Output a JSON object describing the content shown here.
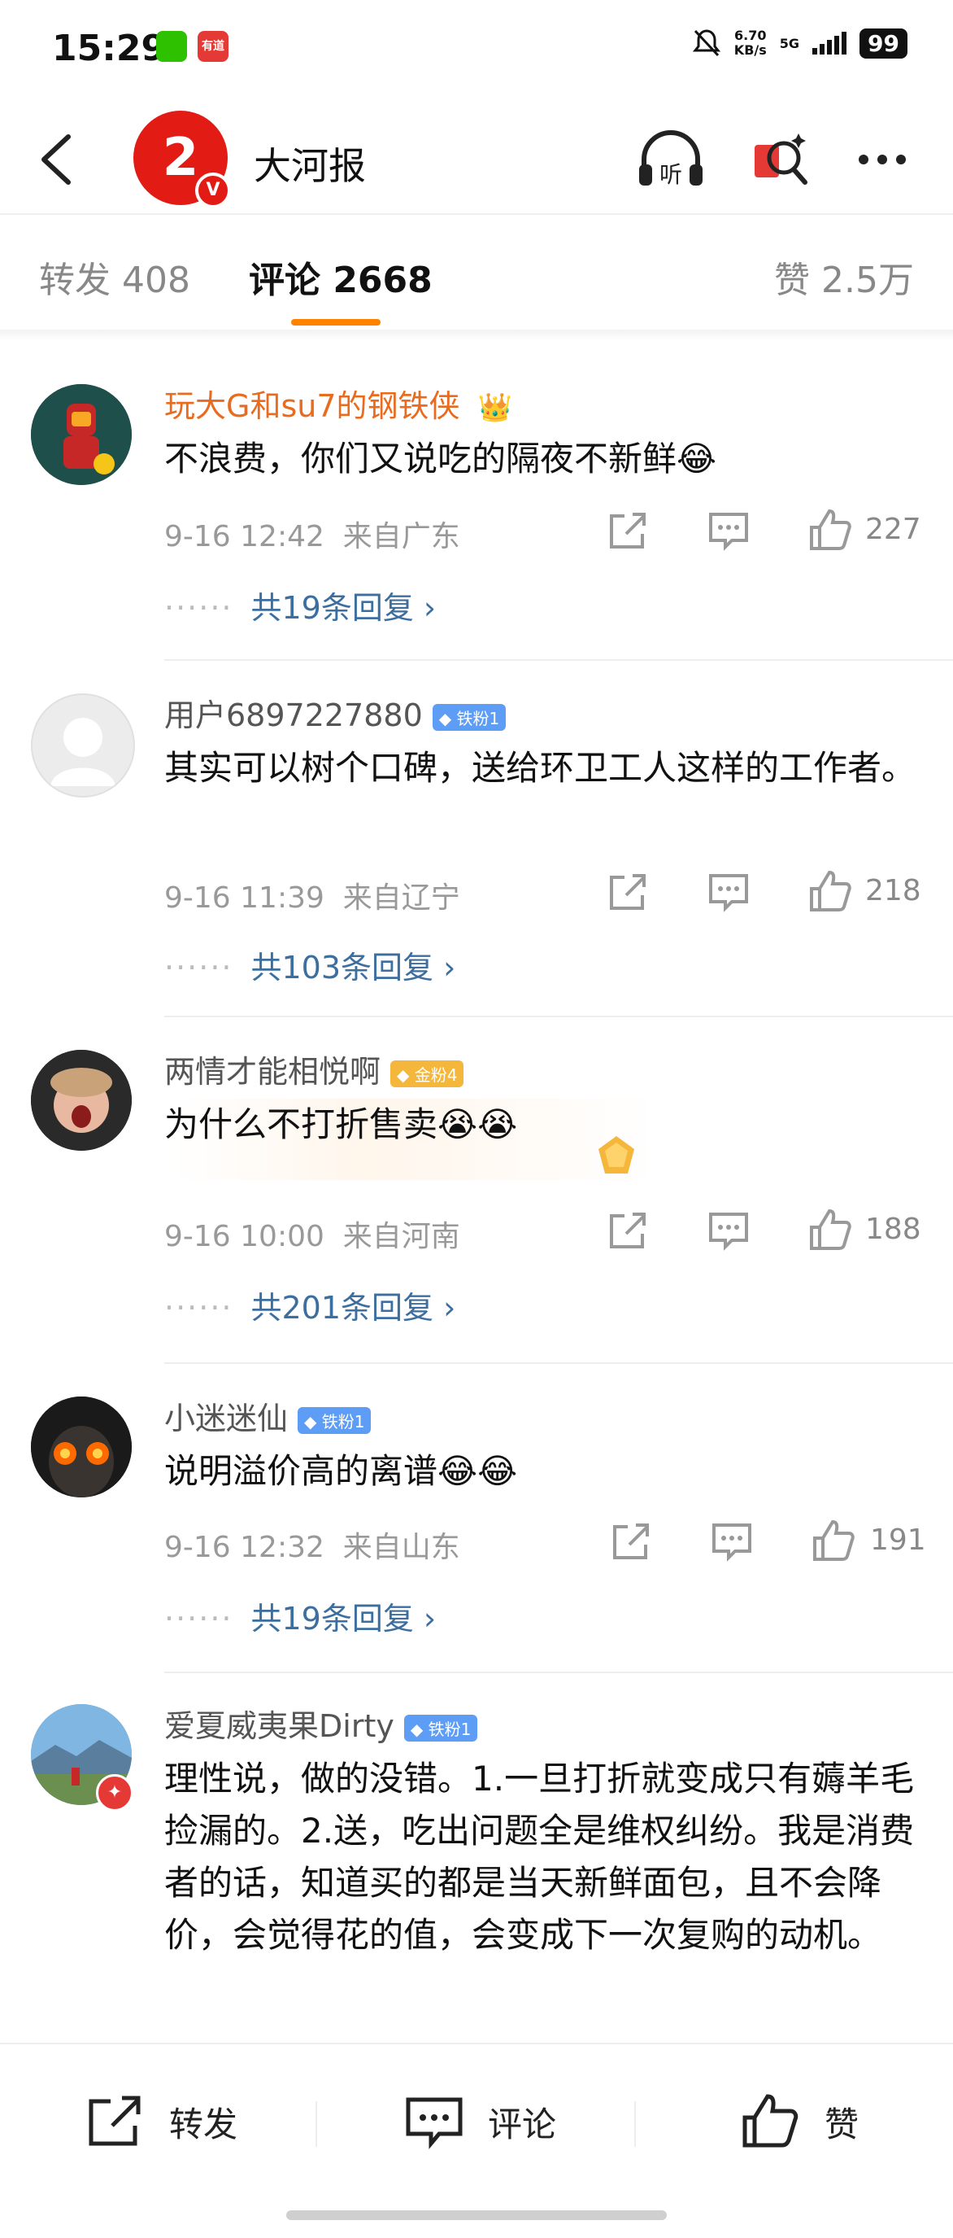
{
  "status_bar": {
    "time": "15:29",
    "app_badge": "有道",
    "speed_value": "6.70",
    "speed_unit": "KB/s",
    "network": "5G",
    "battery": "99"
  },
  "header": {
    "account_name": "大河报",
    "avatar_glyph": "2",
    "verified_mark": "V",
    "listen_label": "听"
  },
  "tabs": {
    "repost": "转发 408",
    "comment": "评论 2668",
    "like": "赞 2.5万"
  },
  "comments": [
    {
      "username": "玩大G和su7的钢铁侠",
      "badge": "",
      "text": "不浪费，你们又说吃的隔夜不新鲜😂",
      "time": "9-16 12:42",
      "location": "来自广东",
      "likes": "227",
      "replies": "共19条回复 ›"
    },
    {
      "username": "用户6897227880",
      "badge": "◆ 铁粉1",
      "text": "其实可以树个口碑，送给环卫工人这样的工作者。",
      "time": "9-16 11:39",
      "location": "来自辽宁",
      "likes": "218",
      "replies": "共103条回复 ›"
    },
    {
      "username": "两情才能相悦啊",
      "badge": "◆ 金粉4",
      "text": "为什么不打折售卖😭😭",
      "time": "9-16 10:00",
      "location": "来自河南",
      "likes": "188",
      "replies": "共201条回复 ›"
    },
    {
      "username": "小迷迷仙",
      "badge": "◆ 铁粉1",
      "text": "说明溢价高的离谱😂😂",
      "time": "9-16 12:32",
      "location": "来自山东",
      "likes": "191",
      "replies": "共19条回复 ›"
    },
    {
      "username": "爱夏威夷果Dirty",
      "badge": "◆ 铁粉1",
      "text": "理性说，做的没错。1.一旦打折就变成只有薅羊毛捡漏的。2.送，吃出问题全是维权纠纷。我是消费者的话，知道买的都是当天新鲜面包，且不会降价，会觉得花的值，会变成下一次复购的动机。",
      "time": "",
      "location": "",
      "likes": "",
      "replies": ""
    }
  ],
  "bottom_bar": {
    "repost": "转发",
    "comment": "评论",
    "like": "赞"
  },
  "colors": {
    "accent": "#ff8200",
    "link": "#3c6ea0",
    "vip_name": "#e86b1f",
    "brand_red": "#e21b14"
  },
  "icons": [
    "back-arrow-icon",
    "headphones-icon",
    "red-packet-search-icon",
    "more-icon",
    "share-icon",
    "comment-icon",
    "like-icon"
  ]
}
